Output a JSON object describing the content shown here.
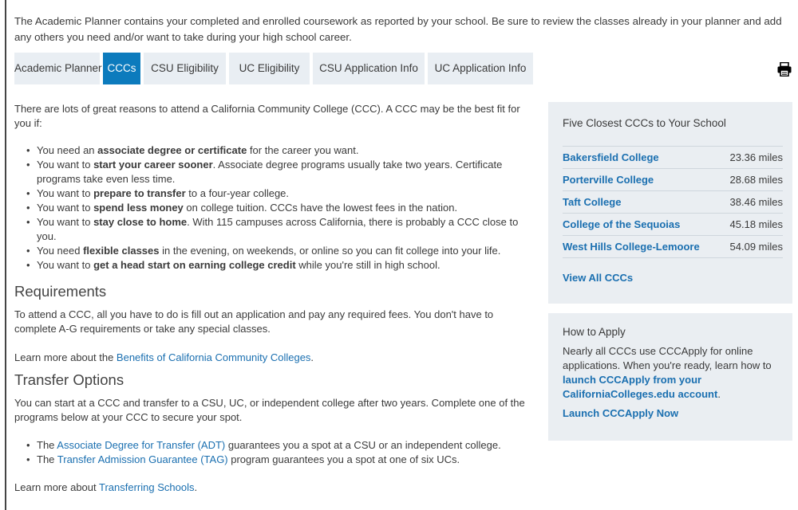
{
  "intro_text": "The Academic Planner contains your completed and enrolled coursework as reported by your school. Be sure to review the classes already in your planner and add any others you need and/or want to take during your high school career.",
  "tabs": [
    {
      "label": "Academic Planner",
      "active": false
    },
    {
      "label": "CCCs",
      "active": true
    },
    {
      "label": "CSU Eligibility",
      "active": false
    },
    {
      "label": "UC Eligibility",
      "active": false
    },
    {
      "label": "CSU Application Info",
      "active": false
    },
    {
      "label": "UC Application Info",
      "active": false
    }
  ],
  "print_icon": "printer-icon",
  "main": {
    "intro": "There are lots of great reasons to attend a California Community College (CCC).  A CCC may be the best fit for you if:",
    "reasons": [
      {
        "pre": "You need an ",
        "bold": "associate degree or certificate",
        "post": " for the career you want."
      },
      {
        "pre": "You want to ",
        "bold": "start your career sooner",
        "post": ".  Associate degree programs usually take two years.  Certificate programs take even less time."
      },
      {
        "pre": "You want to ",
        "bold": "prepare to transfer",
        "post": " to a four-year college."
      },
      {
        "pre": "You want to ",
        "bold": "spend less money",
        "post": " on college tuition. CCCs have the lowest fees in the nation."
      },
      {
        "pre": "You want to ",
        "bold": "stay close to home",
        "post": ". With 115 campuses across California, there is probably a CCC close to you."
      },
      {
        "pre": "You need ",
        "bold": "flexible classes",
        "post": " in the evening, on weekends, or online so you can fit college into your life."
      },
      {
        "pre": "You want to ",
        "bold": "get a head start on earning college credit",
        "post": " while you're still in high school."
      }
    ],
    "requirements_heading": "Requirements",
    "requirements_text": "To attend a CCC, all you have to do is fill out an application and pay any required fees. You don't have to complete A-G requirements or take any special classes.",
    "benefits_pre": "Learn more about the ",
    "benefits_link": "Benefits of California Community Colleges",
    "benefits_post": ".",
    "transfer_heading": "Transfer Options",
    "transfer_text": "You can start at a CCC and transfer to a CSU, UC, or independent college after two years. Complete one of the programs below at your CCC to secure your spot.",
    "transfer_items": [
      {
        "pre": "The ",
        "link": "Associate Degree for Transfer (ADT)",
        "post": " guarantees you a spot at a CSU or an independent college."
      },
      {
        "pre": "The ",
        "link": "Transfer Admission Guarantee (TAG)",
        "post": " program guarantees you a spot at one of six UCs."
      }
    ],
    "transferring_pre": "Learn more about ",
    "transferring_link": "Transferring Schools",
    "transferring_post": "."
  },
  "closest": {
    "heading": "Five Closest CCCs to Your School",
    "colleges": [
      {
        "name": "Bakersfield College",
        "miles": "23.36 miles"
      },
      {
        "name": "Porterville College",
        "miles": "28.68 miles"
      },
      {
        "name": "Taft College",
        "miles": "38.46 miles"
      },
      {
        "name": "College of the Sequoias",
        "miles": "45.18 miles"
      },
      {
        "name": "West Hills College-Lemoore",
        "miles": "54.09 miles"
      }
    ],
    "view_all": "View All CCCs"
  },
  "apply": {
    "heading": "How to Apply",
    "text_pre": "Nearly all CCCs use CCCApply for online applications. When you're ready, learn how to ",
    "text_link": "launch CCCApply from your CaliforniaColleges.edu account",
    "text_post": ".",
    "launch": "Launch CCCApply Now"
  }
}
